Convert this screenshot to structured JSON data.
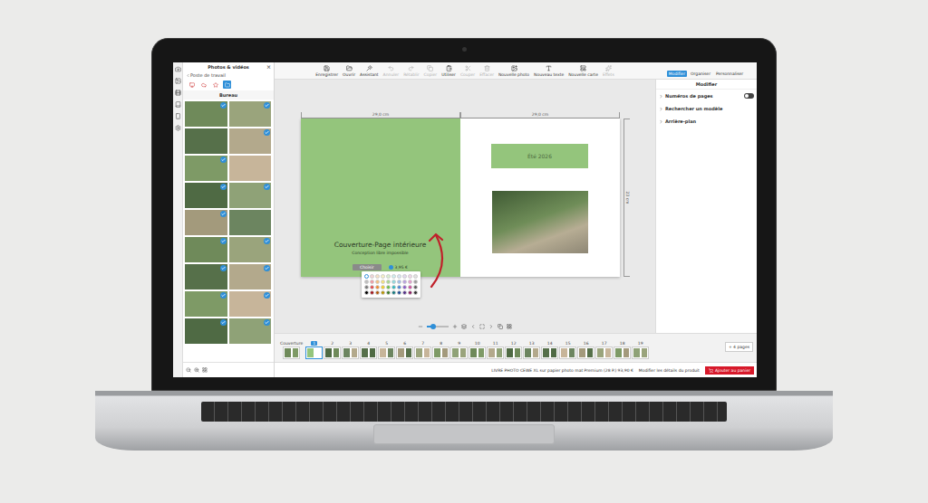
{
  "sidebar": {
    "title": "Photos & vidéos",
    "close": "×",
    "back": "Poste de travail",
    "folder": "Bureau",
    "sources": [
      {
        "selected": false
      },
      {
        "selected": false
      },
      {
        "selected": false
      },
      {
        "selected": true
      }
    ],
    "photos": [
      {
        "selected": true
      },
      {
        "selected": true
      },
      {
        "selected": false
      },
      {
        "selected": true
      },
      {
        "selected": true
      },
      {
        "selected": false
      },
      {
        "selected": true
      },
      {
        "selected": true
      },
      {
        "selected": true
      },
      {
        "selected": false
      },
      {
        "selected": true
      },
      {
        "selected": true
      },
      {
        "selected": true
      },
      {
        "selected": true
      },
      {
        "selected": true
      },
      {
        "selected": true
      },
      {
        "selected": true
      },
      {
        "selected": true
      }
    ]
  },
  "toolbar": {
    "buttons": [
      {
        "label": "Enregistrer",
        "disabled": false
      },
      {
        "label": "Ouvrir",
        "disabled": false
      },
      {
        "label": "Assistant",
        "disabled": false
      },
      {
        "label": "Annuler",
        "disabled": true
      },
      {
        "label": "Rétablir",
        "disabled": true
      },
      {
        "label": "Copier",
        "disabled": true
      },
      {
        "label": "Utiliser",
        "disabled": false
      },
      {
        "label": "Couper",
        "disabled": true
      },
      {
        "label": "Effacer",
        "disabled": true
      },
      {
        "label": "Nouvelle photo",
        "disabled": false
      },
      {
        "label": "Nouveau texte",
        "disabled": false
      },
      {
        "label": "Nouvelle carte",
        "disabled": false
      },
      {
        "label": "Effets",
        "disabled": true
      }
    ]
  },
  "modes": [
    {
      "label": "Modifier",
      "selected": true
    },
    {
      "label": "Organiser",
      "selected": false
    },
    {
      "label": "Personnaliser",
      "selected": false
    }
  ],
  "panel": {
    "title": "Modifier",
    "items": [
      {
        "label": "Numéros de pages",
        "kind": "toggle",
        "on": false,
        "expanded": false
      },
      {
        "label": "Rechercher un modèle",
        "kind": "section",
        "on": false,
        "expanded": false
      },
      {
        "label": "Arrière-plan",
        "kind": "section",
        "on": false,
        "expanded": false
      }
    ]
  },
  "rulers": {
    "left": "29,0 cm",
    "right": "29,0 cm",
    "height": "23 cm"
  },
  "spread": {
    "left": {
      "title": "Couverture-Page intérieure",
      "subtitle": "Conception libre impossible",
      "button": "Choisir",
      "price": "3,95 €"
    },
    "right": {
      "heading": "Été 2026"
    }
  },
  "palette": [
    {
      "color": "#ffffff",
      "selected": true
    },
    {
      "color": "#f2d4d7",
      "selected": false
    },
    {
      "color": "#f6e0c4",
      "selected": false
    },
    {
      "color": "#f7f1c6",
      "selected": false
    },
    {
      "color": "#d9efd0",
      "selected": false
    },
    {
      "color": "#cdeef0",
      "selected": false
    },
    {
      "color": "#d6e4f5",
      "selected": false
    },
    {
      "color": "#e2d7f0",
      "selected": false
    },
    {
      "color": "#f0d5e8",
      "selected": false
    },
    {
      "color": "#e0e0e0",
      "selected": false
    },
    {
      "color": "#bfbfbf",
      "selected": false
    },
    {
      "color": "#f19aa2",
      "selected": false
    },
    {
      "color": "#f5bf7d",
      "selected": false
    },
    {
      "color": "#f4e27a",
      "selected": false
    },
    {
      "color": "#a8d88f",
      "selected": false
    },
    {
      "color": "#8fd9dd",
      "selected": false
    },
    {
      "color": "#9cbce9",
      "selected": false
    },
    {
      "color": "#b9a0df",
      "selected": false
    },
    {
      "color": "#e39ccb",
      "selected": false
    },
    {
      "color": "#9e9e9e",
      "selected": false
    },
    {
      "color": "#7a7a7a",
      "selected": false
    },
    {
      "color": "#e5484d",
      "selected": false
    },
    {
      "color": "#f08c2e",
      "selected": false
    },
    {
      "color": "#f2cf2a",
      "selected": false
    },
    {
      "color": "#6cbf4b",
      "selected": false
    },
    {
      "color": "#2fb8c0",
      "selected": false
    },
    {
      "color": "#4a84d6",
      "selected": false
    },
    {
      "color": "#8a5bc8",
      "selected": false
    },
    {
      "color": "#cf4f9f",
      "selected": false
    },
    {
      "color": "#5c5c5c",
      "selected": false
    },
    {
      "color": "#000000",
      "selected": false
    },
    {
      "color": "#a3141b",
      "selected": false
    },
    {
      "color": "#b45a0e",
      "selected": false
    },
    {
      "color": "#b89400",
      "selected": false
    },
    {
      "color": "#3d7d2a",
      "selected": false
    },
    {
      "color": "#157a80",
      "selected": false
    },
    {
      "color": "#1f4f96",
      "selected": false
    },
    {
      "color": "#55308a",
      "selected": false
    },
    {
      "color": "#8c1f63",
      "selected": false
    },
    {
      "color": "#333333",
      "selected": false
    }
  ],
  "zoom": {
    "level": 0.3
  },
  "thumbnails": {
    "items": [
      {
        "label": "Couverture",
        "selected": false
      },
      {
        "label": "1",
        "selected": true
      },
      {
        "label": "2",
        "selected": false
      },
      {
        "label": "3",
        "selected": false
      },
      {
        "label": "4",
        "selected": false
      },
      {
        "label": "5",
        "selected": false
      },
      {
        "label": "6",
        "selected": false
      },
      {
        "label": "7",
        "selected": false
      },
      {
        "label": "8",
        "selected": false
      },
      {
        "label": "9",
        "selected": false
      },
      {
        "label": "10",
        "selected": false
      },
      {
        "label": "11",
        "selected": false
      },
      {
        "label": "12",
        "selected": false
      },
      {
        "label": "13",
        "selected": false
      },
      {
        "label": "14",
        "selected": false
      },
      {
        "label": "15",
        "selected": false
      },
      {
        "label": "16",
        "selected": false
      },
      {
        "label": "17",
        "selected": false
      },
      {
        "label": "18",
        "selected": false
      },
      {
        "label": "19",
        "selected": false
      }
    ],
    "add": "+ 4 pages"
  },
  "footer": {
    "product": "LIVRE PHOTO CEWE XL sur papier photo mat Premium (28 P.) 93,90 €",
    "details": "Modifier les détails du produit",
    "cart": "Ajouter au panier"
  }
}
